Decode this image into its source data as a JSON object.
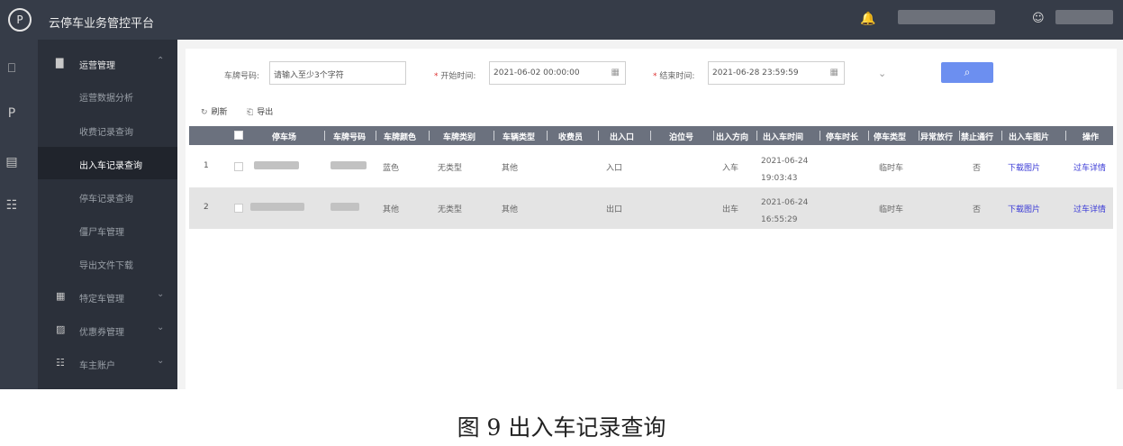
{
  "header": {
    "app_title": "云停车业务管控平台",
    "logo_icon": "cloud-parking-logo",
    "bell_icon": "bell-icon",
    "user_icon": "user-icon"
  },
  "rail": [
    "monitor-icon",
    "parking-icon",
    "record-icon",
    "grid-icon"
  ],
  "sidebar": {
    "group_label": "运营管理",
    "items": [
      {
        "label": "运营数据分析"
      },
      {
        "label": "收费记录查询"
      },
      {
        "label": "出入车记录查询"
      },
      {
        "label": "停车记录查询"
      },
      {
        "label": "僵尸车管理"
      },
      {
        "label": "导出文件下载"
      },
      {
        "label": "特定车管理"
      },
      {
        "label": "优惠券管理"
      },
      {
        "label": "车主账户"
      }
    ]
  },
  "filters": {
    "plate_label": "车牌号码:",
    "plate_placeholder": "请输入至少3个字符",
    "start_label": "开始时间:",
    "start_value": "2021-06-02 00:00:00",
    "end_label": "结束时间:",
    "end_value": "2021-06-28 23:59:59",
    "required_mark": "*",
    "search_icon": "search-icon"
  },
  "toolbar": {
    "refresh_label": "刷新",
    "export_label": "导出"
  },
  "table": {
    "columns": [
      "停车场",
      "车牌号码",
      "车牌颜色",
      "车牌类别",
      "车辆类型",
      "收费员",
      "出入口",
      "泊位号",
      "出入方向",
      "出入车时间",
      "停车时长",
      "停车类型",
      "异常放行",
      "禁止通行",
      "出入车图片",
      "操作"
    ],
    "rows": [
      {
        "index": "1",
        "plate_color": "蓝色",
        "plate_class": "无类型",
        "vehicle_type": "其他",
        "gate": "入口",
        "direction": "入车",
        "time_date": "2021-06-24",
        "time_clock": "19:03:43",
        "parking_type": "临时车",
        "no_pass": "否",
        "image_action": "下载图片",
        "detail_action": "过车详情"
      },
      {
        "index": "2",
        "plate_color": "其他",
        "plate_class": "无类型",
        "vehicle_type": "其他",
        "gate": "出口",
        "direction": "出车",
        "time_date": "2021-06-24",
        "time_clock": "16:55:29",
        "parking_type": "临时车",
        "no_pass": "否",
        "image_action": "下载图片",
        "detail_action": "过车详情"
      }
    ]
  },
  "caption": "图 9  出入车记录查询"
}
